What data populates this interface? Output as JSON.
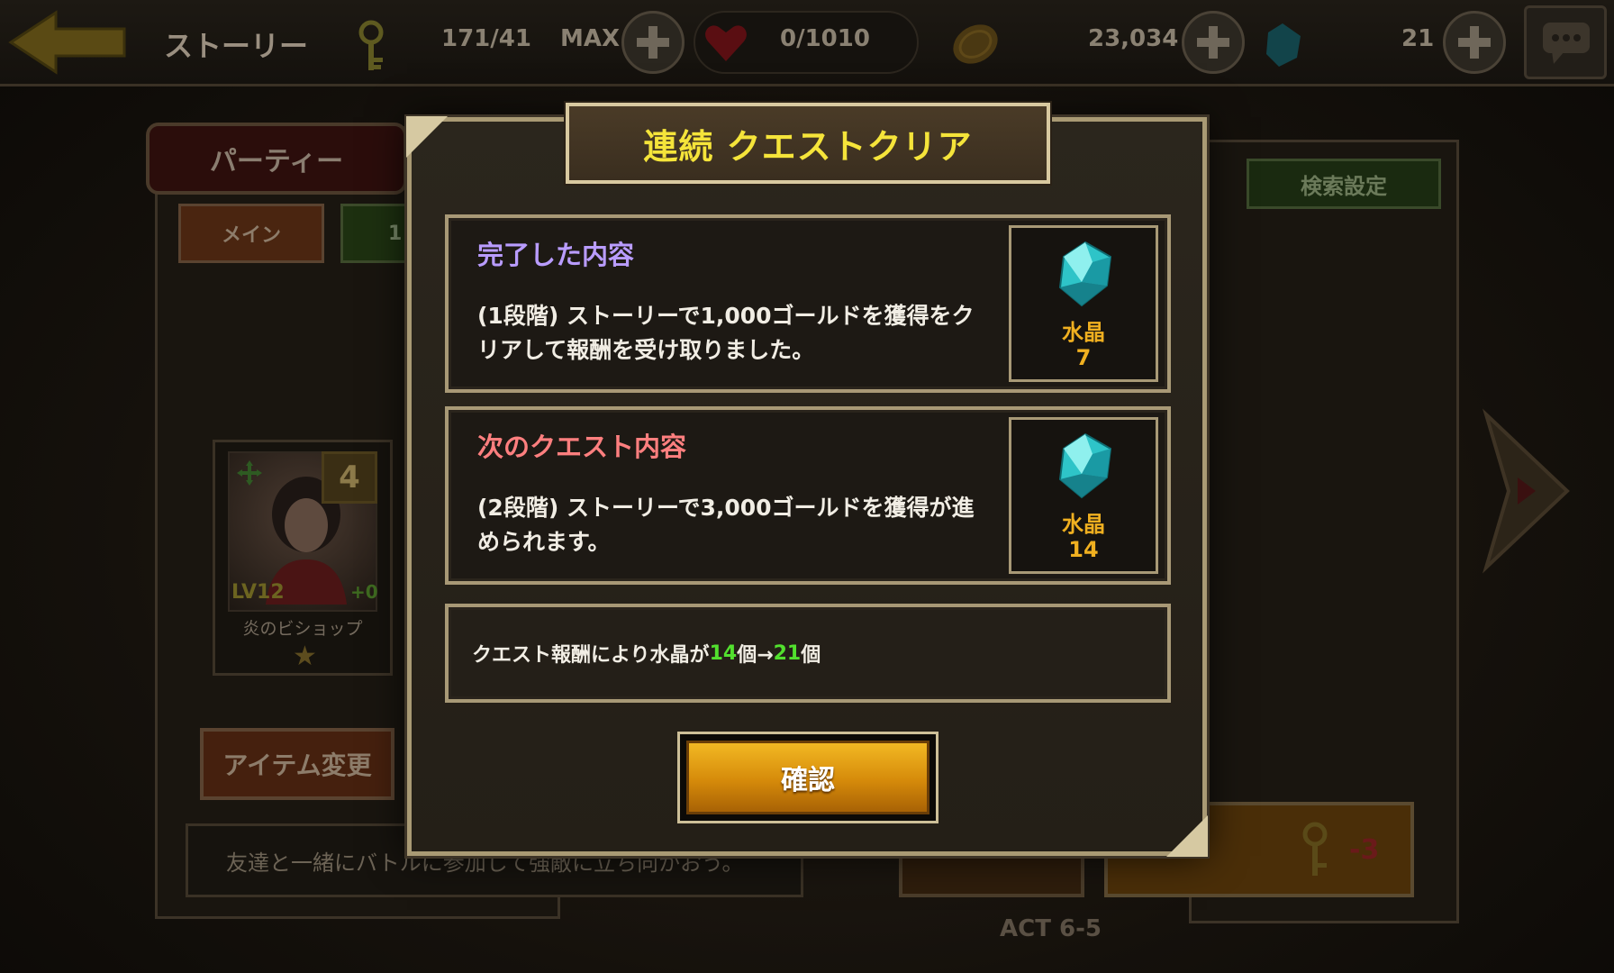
{
  "topbar": {
    "title": "ストーリー",
    "keys": "171/41",
    "keys_max": "MAX",
    "hearts": "0/1010",
    "gold": "23,034",
    "crystals": "21"
  },
  "party": {
    "tab_label": "パーティー",
    "main_tab": "メイン",
    "second_tab": "1",
    "character": {
      "level_badge": "4",
      "lv": "LV12",
      "plus": "+0",
      "name": "炎のビショップ",
      "star": "★"
    },
    "item_button": "アイテム変更",
    "info_text": "友達と一緒にバトルに参加して強敵に立ち向かおう。"
  },
  "right_panel": {
    "search_button": "検索設定",
    "enter_cost": "-3",
    "act_label": "ACT 6-5"
  },
  "modal": {
    "title": "連続 クエストクリア",
    "completed": {
      "heading": "完了した内容",
      "description": "(1段階) ストーリーで1,000ゴールドを獲得をクリアして報酬を受け取りました。",
      "reward_label": "水晶",
      "reward_count": "7"
    },
    "next": {
      "heading": "次のクエスト内容",
      "description": "(2段階) ストーリーで3,000ゴールドを獲得が進められます。",
      "reward_label": "水晶",
      "reward_count": "14"
    },
    "result": {
      "prefix": "クエスト報酬により水晶が",
      "from": "14",
      "unit1": "個→",
      "to": "21",
      "unit2": "個"
    },
    "confirm_button": "確認"
  },
  "colors": {
    "title_yellow": "#f5e43a",
    "completed_heading": "#b99cff",
    "next_heading": "#ff7f7f",
    "reward_orange": "#f0b020",
    "highlight_green": "#52e02e",
    "button_gold": "#e0a010"
  },
  "icons": {
    "back": "back-arrow-icon",
    "key": "key-icon",
    "heart": "heart-icon",
    "gold": "gold-coin-icon",
    "crystal": "crystal-icon",
    "chat": "chat-icon"
  }
}
